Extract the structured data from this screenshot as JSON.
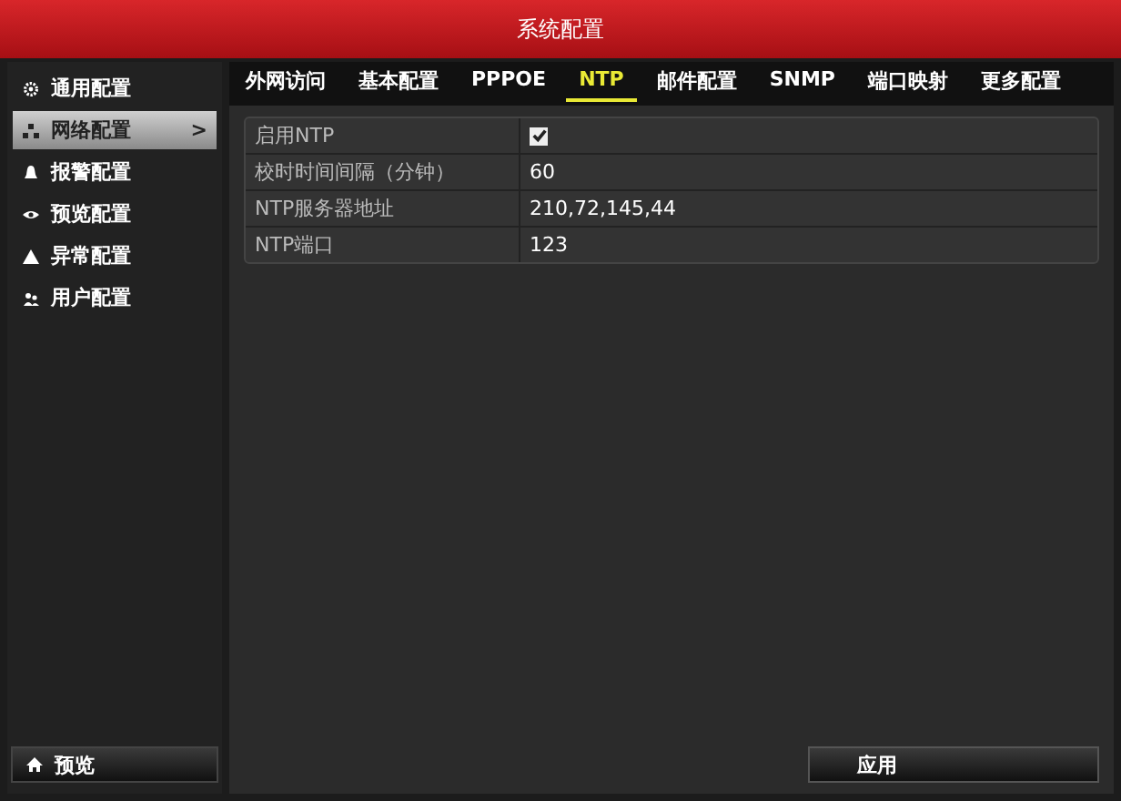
{
  "window": {
    "title": "系统配置"
  },
  "sidebar": {
    "items": [
      {
        "label": "通用配置",
        "selected": false
      },
      {
        "label": "网络配置",
        "selected": true,
        "arrow": ">"
      },
      {
        "label": "报警配置",
        "selected": false
      },
      {
        "label": "预览配置",
        "selected": false
      },
      {
        "label": "异常配置",
        "selected": false
      },
      {
        "label": "用户配置",
        "selected": false
      }
    ],
    "bottom_button": "预览"
  },
  "tabs": [
    {
      "label": "外网访问",
      "selected": false
    },
    {
      "label": "基本配置",
      "selected": false
    },
    {
      "label": "PPPOE",
      "selected": false
    },
    {
      "label": "NTP",
      "selected": true
    },
    {
      "label": "邮件配置",
      "selected": false
    },
    {
      "label": "SNMP",
      "selected": false
    },
    {
      "label": "端口映射",
      "selected": false
    },
    {
      "label": "更多配置",
      "selected": false
    }
  ],
  "settings": [
    {
      "label": "启用NTP",
      "kind": "checkbox",
      "checked": true
    },
    {
      "label": "校时时间间隔（分钟）",
      "kind": "text",
      "value": "60"
    },
    {
      "label": "NTP服务器地址",
      "kind": "text",
      "value": "210,72,145,44"
    },
    {
      "label": "NTP端口",
      "kind": "text",
      "value": "123"
    }
  ],
  "buttons": [
    "应用"
  ]
}
